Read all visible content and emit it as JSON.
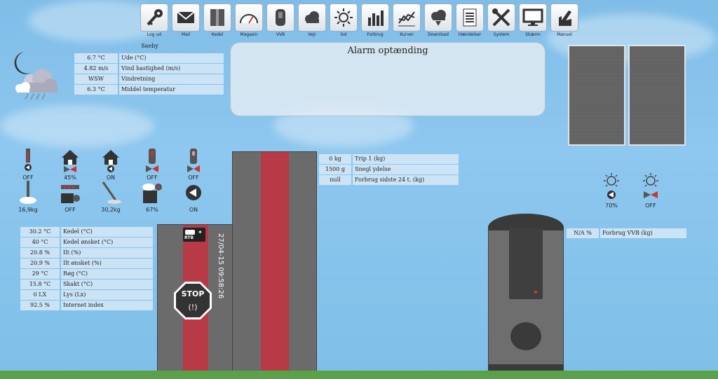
{
  "toolbar": [
    {
      "label": "Log ud",
      "icon": "key-icon"
    },
    {
      "label": "Mail",
      "icon": "mail-icon"
    },
    {
      "label": "Kedel",
      "icon": "boiler-icon"
    },
    {
      "label": "Magasin",
      "icon": "gauge-icon"
    },
    {
      "label": "VVB",
      "icon": "water-heater-icon"
    },
    {
      "label": "Vejr",
      "icon": "cloud-icon"
    },
    {
      "label": "Sol",
      "icon": "sun-icon"
    },
    {
      "label": "Forbrug",
      "icon": "bar-chart-icon"
    },
    {
      "label": "Kurver",
      "icon": "line-chart-icon"
    },
    {
      "label": "Download",
      "icon": "download-icon"
    },
    {
      "label": "Hændelser",
      "icon": "document-icon"
    },
    {
      "label": "System",
      "icon": "tools-icon"
    },
    {
      "label": "Skærm",
      "icon": "monitor-icon"
    },
    {
      "label": "Manuel",
      "icon": "hand-icon"
    }
  ],
  "weather": {
    "location": "Saeby",
    "rows": [
      {
        "value": "6.7 °C",
        "label": "Ude (°C)"
      },
      {
        "value": "4.82 m/s",
        "label": "Vind hastighed (m/s)"
      },
      {
        "value": "WSW",
        "label": "Vindretning"
      },
      {
        "value": "6.3 °C",
        "label": "Middel temperatur"
      }
    ]
  },
  "alarm": {
    "title": "Alarm optænding"
  },
  "status_icons": [
    {
      "value": "OFF",
      "icon": "thermometer-icon"
    },
    {
      "value": "45%",
      "icon": "house-valve-icon"
    },
    {
      "value": "ON",
      "icon": "house-pump-icon"
    },
    {
      "value": "OFF",
      "icon": "boiler-valve-icon"
    },
    {
      "value": "OFF",
      "icon": "boiler-valve-icon"
    },
    {
      "value": "16,9kg",
      "icon": "ash-icon"
    },
    {
      "value": "OFF",
      "icon": "auger-icon"
    },
    {
      "value": "30,2kg",
      "icon": "scale-icon"
    },
    {
      "value": "67%",
      "icon": "fan-icon"
    },
    {
      "value": "ON",
      "icon": "pump-icon"
    }
  ],
  "magazine": {
    "rows": [
      {
        "value": "0 kg",
        "label": "Trip 1 (kg)"
      },
      {
        "value": "1500 g",
        "label": "Snegl ydelse"
      },
      {
        "value": "null",
        "label": "Forbrug sidste 24 t. (kg)"
      }
    ]
  },
  "boiler": {
    "rows": [
      {
        "value": "30.2 °C",
        "label": "Kedel (°C)"
      },
      {
        "value": "40 °C",
        "label": "Kedel ønsket (°C)"
      },
      {
        "value": "20.8 %",
        "label": "Ilt (%)"
      },
      {
        "value": "20.9 %",
        "label": "Ilt ønsket (%)"
      },
      {
        "value": "29 °C",
        "label": "Røg (°C)"
      },
      {
        "value": "15.8 °C",
        "label": "Skakt (°C)"
      },
      {
        "value": "0 LX",
        "label": "Lys (Lx)"
      },
      {
        "value": "92.5 %",
        "label": "Internet index"
      }
    ],
    "datetime": "27/04-15 09:58:26",
    "brand": "RTB",
    "stop_label": "STOP"
  },
  "solar": {
    "items": [
      {
        "value": "70%",
        "icon": "sun-pump-icon"
      },
      {
        "value": "OFF",
        "icon": "sun-valve-icon"
      }
    ]
  },
  "vvb": {
    "rows": [
      {
        "value": "N/A %",
        "label": "Forbrug VVB (kg)"
      }
    ]
  },
  "colors": {
    "sky": "#8ec7ef",
    "boiler_red": "#b93a47",
    "boiler_gray": "#6e6e6e",
    "ground": "#5aa14a"
  }
}
